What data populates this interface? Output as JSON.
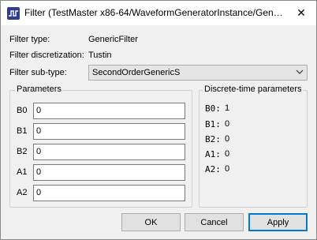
{
  "window": {
    "title": "Filter (TestMaster x86-64/WaveformGeneratorInstance/Generic...",
    "icon": "waveform-app-icon",
    "close_glyph": "✕"
  },
  "info": {
    "filter_type_label": "Filter type:",
    "filter_type_value": "GenericFilter",
    "discretization_label": "Filter discretization:",
    "discretization_value": "Tustin",
    "subtype_label": "Filter sub-type:",
    "subtype_value": "SecondOrderGenericS",
    "subtype_arrow": "⌄"
  },
  "parameters": {
    "title": "Parameters",
    "rows": [
      {
        "label": "B0",
        "value": "0"
      },
      {
        "label": "B1",
        "value": "0"
      },
      {
        "label": "B2",
        "value": "0"
      },
      {
        "label": "A1",
        "value": "0"
      },
      {
        "label": "A2",
        "value": "0"
      }
    ]
  },
  "discrete": {
    "title": "Discrete-time parameters",
    "rows": [
      {
        "label": "B0:",
        "value": "1"
      },
      {
        "label": "B1:",
        "value": "0"
      },
      {
        "label": "B2:",
        "value": "0"
      },
      {
        "label": "A1:",
        "value": "0"
      },
      {
        "label": "A2:",
        "value": "0"
      }
    ]
  },
  "buttons": {
    "ok": "OK",
    "cancel": "Cancel",
    "apply": "Apply"
  },
  "colors": {
    "accent": "#0078d7",
    "window_bg": "#f0f0f0",
    "icon_bg": "#2f3d8f"
  }
}
